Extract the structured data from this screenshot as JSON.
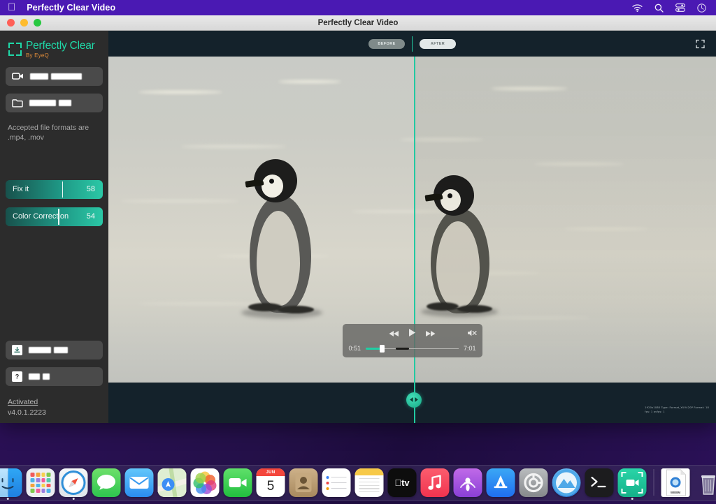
{
  "menubar": {
    "apple_icon": "apple-logo-icon",
    "app_name": "Perfectly Clear Video",
    "status_icons": [
      "wifi-icon",
      "search-icon",
      "control-center-icon",
      "siri-icon"
    ]
  },
  "window": {
    "title": "Perfectly Clear Video",
    "traffic_lights": [
      "close-button",
      "minimize-button",
      "zoom-button"
    ]
  },
  "sidebar": {
    "logo": {
      "name": "Perfectly Clear",
      "byline": "By EyeQ",
      "brand_color": "#1fd9a8",
      "byline_color": "#e08c3a"
    },
    "buttons": [
      {
        "name": "open-video-button",
        "icon": "video-camera-icon",
        "label": "",
        "redacted": true
      },
      {
        "name": "choose-folder-button",
        "icon": "folder-icon",
        "label": "",
        "redacted": true
      }
    ],
    "note": "Accepted file formats are .mp4, .mov",
    "note_line1": "Accepted file formats are",
    "note_line2": ".mp4, .mov",
    "sliders": [
      {
        "label": "Fix it",
        "value": 58,
        "max": 100,
        "name": "fix-it-slider"
      },
      {
        "label": "Color Correction",
        "value": 54,
        "max": 100,
        "name": "color-correction-slider"
      }
    ],
    "bottom_buttons": [
      {
        "name": "save-button",
        "icon": "download-icon",
        "label": "",
        "redacted": true
      },
      {
        "name": "help-button",
        "icon": "question-mark-icon",
        "label": "",
        "redacted": true
      }
    ],
    "license_status": "Activated",
    "version": "v4.0.1.2223"
  },
  "main": {
    "toolbar": {
      "before_label": "BEFORE",
      "after_label": "AFTER",
      "selected": "AFTER",
      "expand_icon": "expand-fullscreen-icon"
    },
    "player": {
      "current_time": "0:51",
      "duration": "7:01",
      "progress_percent": 15,
      "rewind_icon": "rewind-icon",
      "play_icon": "play-icon",
      "forward_icon": "fast-forward-icon",
      "mute_icon": "mute-icon",
      "muted": true
    },
    "split_handle": {
      "name": "before-after-split-handle",
      "icon": "left-right-arrows-icon",
      "position_percent": 50.3
    },
    "metadata_line1": "1920x1080 Type: Format_YUV420P Format: 18",
    "metadata_line2": "fps: 1 avfps: 1",
    "accent_color": "#22c9a2"
  },
  "dock": {
    "items": [
      {
        "name": "dock-finder",
        "label": "Finder",
        "running": true
      },
      {
        "name": "dock-launchpad",
        "label": "Launchpad",
        "running": false
      },
      {
        "name": "dock-safari",
        "label": "Safari",
        "running": true
      },
      {
        "name": "dock-messages",
        "label": "Messages",
        "running": false
      },
      {
        "name": "dock-mail",
        "label": "Mail",
        "running": false
      },
      {
        "name": "dock-maps",
        "label": "Maps",
        "running": false
      },
      {
        "name": "dock-photos",
        "label": "Photos",
        "running": false
      },
      {
        "name": "dock-facetime",
        "label": "FaceTime",
        "running": false
      },
      {
        "name": "dock-calendar",
        "label": "Calendar",
        "running": false,
        "month": "JUN",
        "day": "5"
      },
      {
        "name": "dock-contacts",
        "label": "Contacts",
        "running": false
      },
      {
        "name": "dock-reminders",
        "label": "Reminders",
        "running": false
      },
      {
        "name": "dock-notes",
        "label": "Notes",
        "running": false
      },
      {
        "name": "dock-appletv",
        "label": "Apple TV",
        "running": false
      },
      {
        "name": "dock-music",
        "label": "Music",
        "running": false
      },
      {
        "name": "dock-podcasts",
        "label": "Podcasts",
        "running": false
      },
      {
        "name": "dock-appstore",
        "label": "App Store",
        "running": false
      },
      {
        "name": "dock-system-settings",
        "label": "System Settings",
        "running": false
      },
      {
        "name": "dock-app-cleaner",
        "label": "App Cleaner",
        "running": false
      },
      {
        "name": "dock-terminal",
        "label": "Terminal",
        "running": false
      },
      {
        "name": "dock-perfectly-clear-video",
        "label": "Perfectly Clear Video",
        "running": true
      }
    ],
    "file_item": {
      "name": "dock-webm-file",
      "label": "WEBM"
    },
    "trash": {
      "name": "dock-trash",
      "label": "Trash"
    }
  }
}
